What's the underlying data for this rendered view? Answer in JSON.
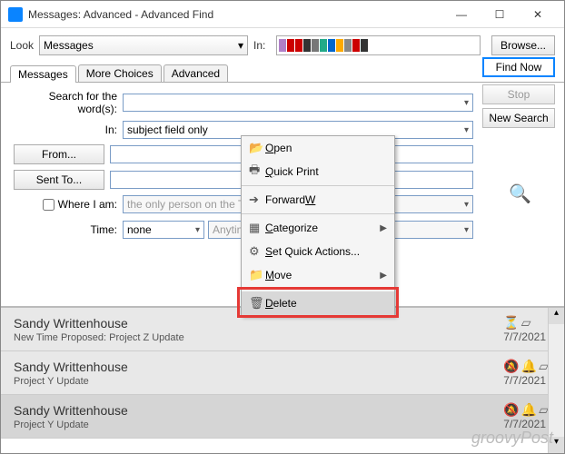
{
  "titlebar": {
    "title": "Messages: Advanced - Advanced Find"
  },
  "topbar": {
    "look_label": "Look",
    "look_value": "Messages",
    "in_label": "In:",
    "browse_label": "Browse..."
  },
  "tabs": [
    "Messages",
    "More Choices",
    "Advanced"
  ],
  "active_tab": 0,
  "buttons": {
    "find_now": "Find Now",
    "stop": "Stop",
    "new_search": "New Search"
  },
  "form": {
    "search_label": "Search for the word(s):",
    "search_value": "",
    "in_label": "In:",
    "in_value": "subject field only",
    "from_btn": "From...",
    "from_value": "",
    "sent_btn": "Sent To...",
    "sent_value": "",
    "where_label": "Where I am:",
    "where_checked": false,
    "where_value": "the only person on the To line",
    "time_label": "Time:",
    "time_value": "none",
    "anytime_value": "Anytime"
  },
  "context_menu": [
    {
      "icon": "📂",
      "label": "Open",
      "u": "O"
    },
    {
      "icon": "🖶",
      "label": "Quick Print",
      "u": "Q"
    },
    {
      "sep": true
    },
    {
      "icon": "➔",
      "label": "Forward",
      "u": "W"
    },
    {
      "sep": true
    },
    {
      "icon": "▦",
      "label": "Categorize",
      "u": "C",
      "arrow": true
    },
    {
      "icon": "⚙",
      "label": "Set Quick Actions...",
      "u": "S"
    },
    {
      "icon": "📁",
      "label": "Move",
      "u": "M",
      "arrow": true
    },
    {
      "sep": true
    },
    {
      "icon": "🗑",
      "label": "Delete",
      "u": "D",
      "hover": true
    }
  ],
  "results": [
    {
      "who": "Sandy Writtenhouse",
      "subj": "New Time Proposed: Project Z Update",
      "date": "7/7/2021",
      "icons": "⏳▱"
    },
    {
      "who": "Sandy Writtenhouse",
      "subj": "Project Y Update",
      "date": "7/7/2021",
      "icons": "🔔▱",
      "bell": true
    },
    {
      "who": "Sandy Writtenhouse",
      "subj": "Project Y Update",
      "date": "7/7/2021",
      "icons": "🔔▱",
      "bell": true,
      "sel": true
    }
  ],
  "watermark": "groovyPost"
}
